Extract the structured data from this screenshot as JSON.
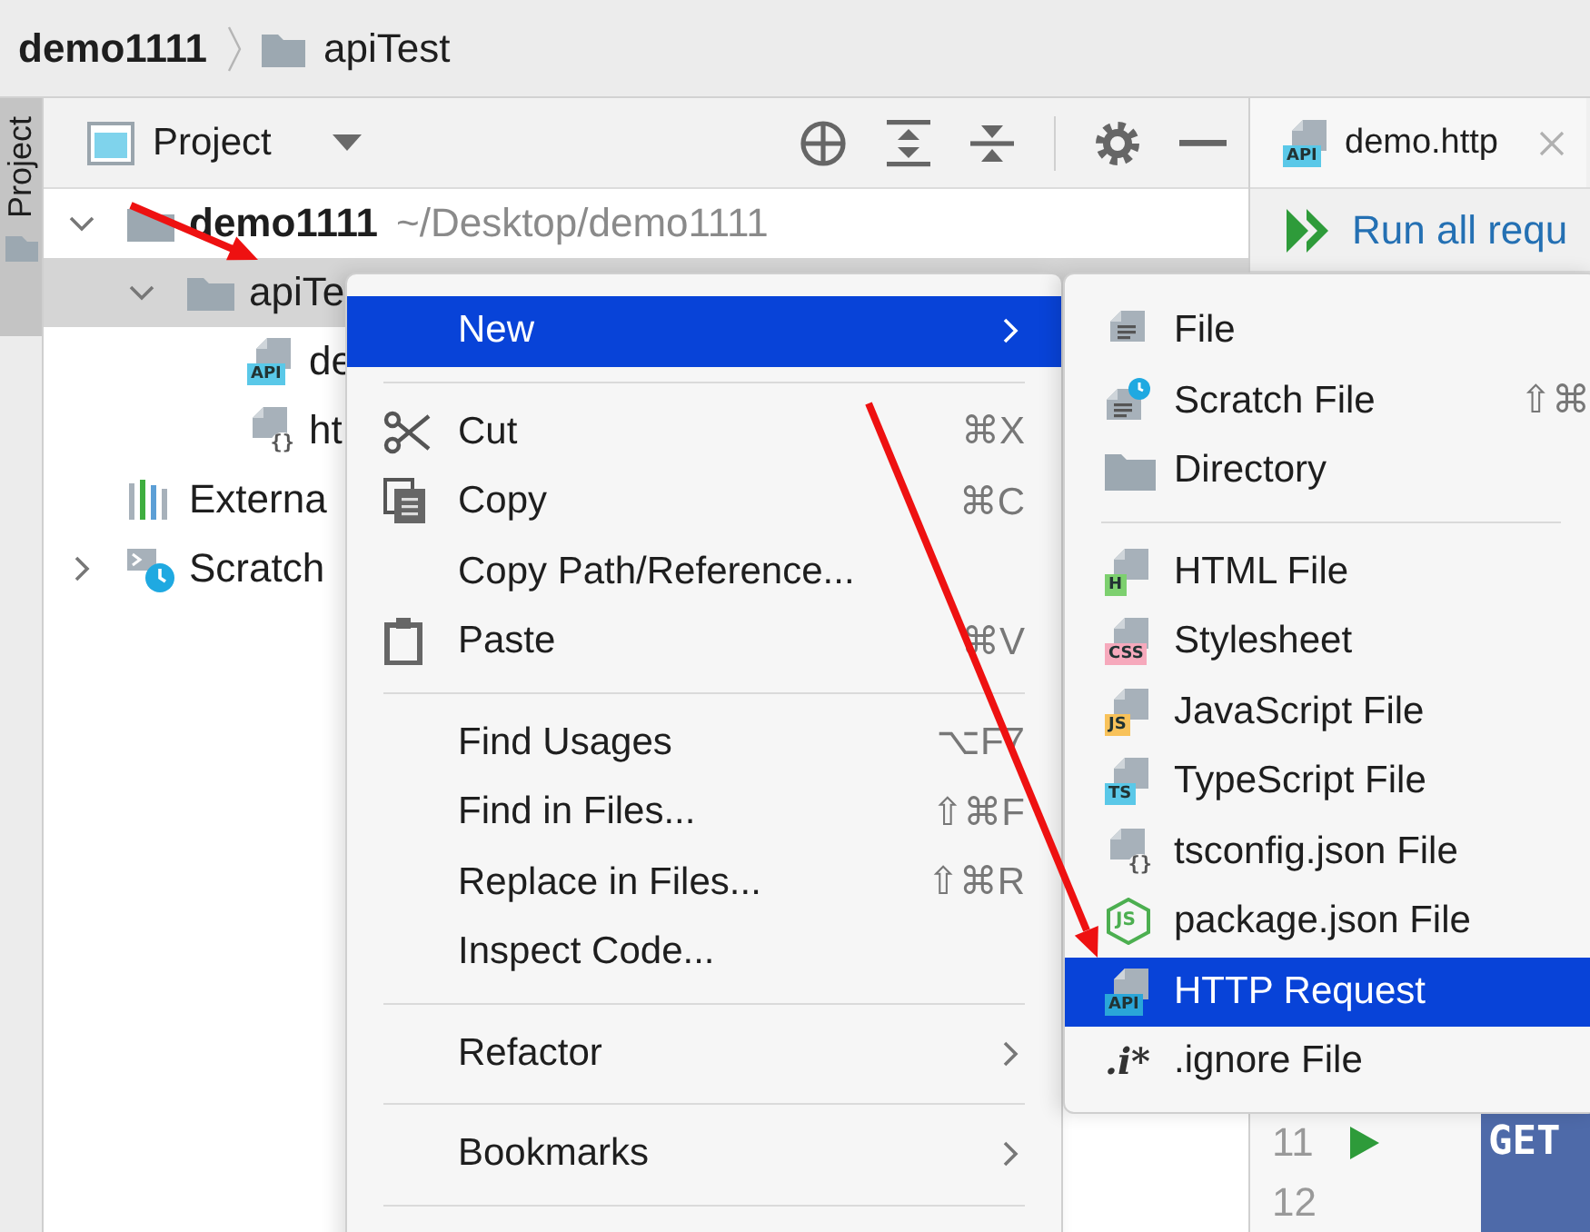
{
  "breadcrumb": [
    {
      "label": "demo1111",
      "kind": "project"
    },
    {
      "label": "apiTest",
      "kind": "folder"
    }
  ],
  "side_strip": {
    "tab": {
      "label": "Project",
      "selected": true
    }
  },
  "project_panel": {
    "title": "Project",
    "tree": [
      {
        "label": "demo1111",
        "path": "~/Desktop/demo1111",
        "kind": "folder",
        "expanded": true,
        "selected": false,
        "children": [
          {
            "label": "apiTe",
            "kind": "folder",
            "expanded": true,
            "selected": true,
            "children": [
              {
                "label": "de",
                "kind": "badge",
                "badge": "API",
                "color": "#5ac8e8",
                "selected": false
              },
              {
                "label": "ht",
                "kind": "json",
                "badge": "{}",
                "selected": false
              }
            ]
          }
        ]
      },
      {
        "label": "Externa",
        "kind": "libraries",
        "selected": false
      },
      {
        "label": "Scratch",
        "kind": "scratch",
        "expanded": false,
        "selected": false
      }
    ]
  },
  "editor": {
    "tab": {
      "label": "demo.http",
      "badge": "API",
      "color": "#5ac8e8",
      "selected": true
    },
    "run_all": "Run all requ",
    "lines": [
      {
        "number": "11",
        "run": true,
        "code": "GET"
      },
      {
        "number": "12",
        "run": false
      }
    ]
  },
  "context_menu": {
    "items": [
      {
        "kind": "plain",
        "label": "New",
        "submenu": true,
        "selected": true
      },
      {
        "kind": "separator"
      },
      {
        "kind": "cut",
        "label": "Cut",
        "shortcut": "⌘X",
        "submenu": false,
        "selected": false
      },
      {
        "kind": "copy",
        "label": "Copy",
        "shortcut": "⌘C",
        "submenu": false,
        "selected": false
      },
      {
        "kind": "plain",
        "label": "Copy Path/Reference...",
        "submenu": false,
        "selected": false
      },
      {
        "kind": "paste",
        "label": "Paste",
        "shortcut": "⌘V",
        "submenu": false,
        "selected": false
      },
      {
        "kind": "separator"
      },
      {
        "kind": "plain",
        "label": "Find Usages",
        "shortcut": "⌥F7",
        "submenu": false,
        "selected": false
      },
      {
        "kind": "plain",
        "label": "Find in Files...",
        "shortcut": "⇧⌘F",
        "submenu": false,
        "selected": false
      },
      {
        "kind": "plain",
        "label": "Replace in Files...",
        "shortcut": "⇧⌘R",
        "submenu": false,
        "selected": false
      },
      {
        "kind": "plain",
        "label": "Inspect Code...",
        "submenu": false,
        "selected": false
      },
      {
        "kind": "separator"
      },
      {
        "kind": "plain",
        "label": "Refactor",
        "submenu": true,
        "selected": false
      },
      {
        "kind": "separator"
      },
      {
        "kind": "plain",
        "label": "Bookmarks",
        "submenu": true,
        "selected": false
      },
      {
        "kind": "separator"
      }
    ]
  },
  "new_submenu": {
    "items": [
      {
        "kind": "file",
        "label": "File",
        "selected": false
      },
      {
        "kind": "scratchfile",
        "label": "Scratch File",
        "shortcut": "⇧⌘",
        "selected": false
      },
      {
        "kind": "directory",
        "label": "Directory",
        "selected": false
      },
      {
        "kind": "separator"
      },
      {
        "kind": "badge",
        "badge": "H",
        "color": "#7dd06f",
        "label": "HTML File",
        "selected": false
      },
      {
        "kind": "badge",
        "badge": "CSS",
        "color": "#f6a9bc",
        "label": "Stylesheet",
        "selected": false
      },
      {
        "kind": "badge",
        "badge": "JS",
        "color": "#f8c25a",
        "label": "JavaScript File",
        "selected": false
      },
      {
        "kind": "badge",
        "badge": "TS",
        "color": "#5ac8e8",
        "label": "TypeScript File",
        "selected": false
      },
      {
        "kind": "json",
        "badge": "{}",
        "label": "tsconfig.json File",
        "selected": false
      },
      {
        "kind": "node",
        "badge": "JS",
        "label": "package.json File",
        "selected": false
      },
      {
        "kind": "badge",
        "badge": "API",
        "color": "#2aa6d8",
        "label": "HTTP Request",
        "selected": true
      },
      {
        "kind": "glyph",
        "glyph": ".i*",
        "label": ".ignore File",
        "selected": false
      }
    ]
  }
}
